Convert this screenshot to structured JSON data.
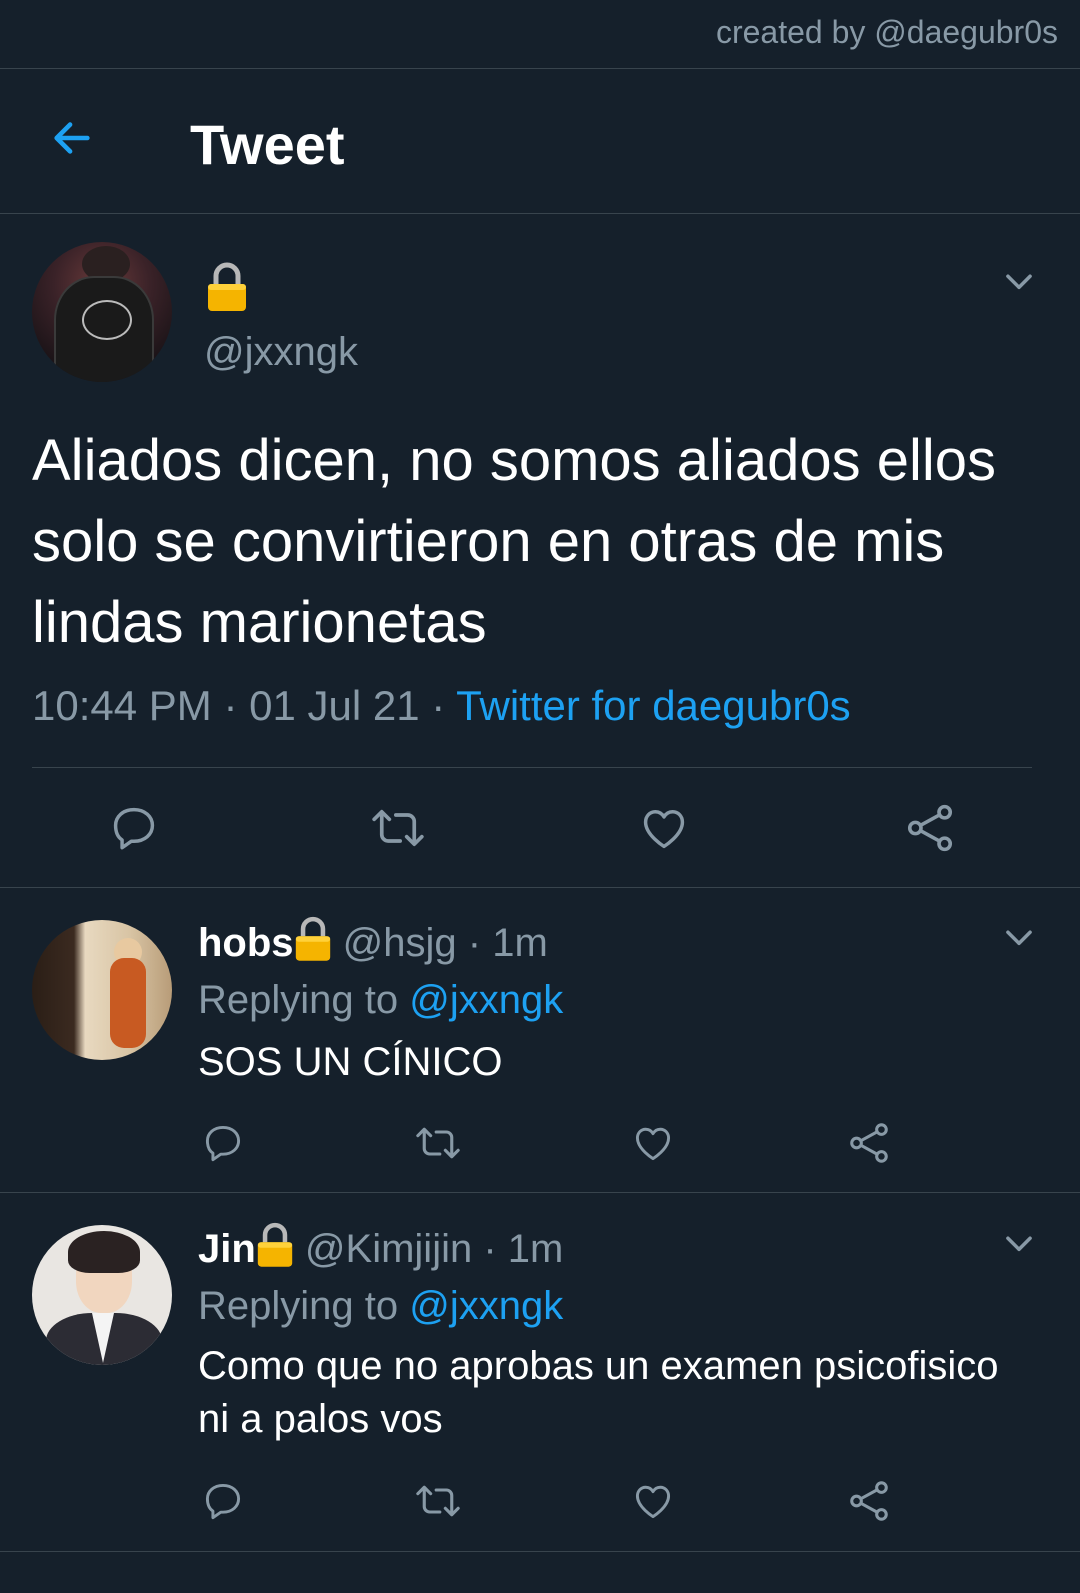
{
  "watermark": "created by @daegubr0s",
  "header": {
    "title": "Tweet",
    "back_icon": "arrow-left-icon"
  },
  "colors": {
    "background": "#15202b",
    "divider": "#38444d",
    "secondary_text": "#8899a6",
    "accent": "#1da1f2",
    "primary_text": "#ffffff"
  },
  "main_tweet": {
    "name": "",
    "protected": true,
    "handle": "@jxxngk",
    "text": "Aliados dicen, no somos aliados ellos solo se convirtieron en otras de mis lindas marionetas",
    "time": "10:44 PM",
    "date": "01 Jul 21",
    "source": "Twitter for daegubr0s",
    "sep": " · ",
    "actions": [
      "reply-icon",
      "retweet-icon",
      "like-icon",
      "share-icon"
    ]
  },
  "replies": [
    {
      "name": "hobs",
      "protected": true,
      "handle": "@hsjg",
      "time": "1m",
      "replying_label": "Replying to",
      "replying_to": "@jxxngk",
      "text": "SOS UN CÍNICO"
    },
    {
      "name": "Jin",
      "protected": true,
      "handle": "@Kimjijin",
      "time": "1m",
      "replying_label": "Replying to",
      "replying_to": "@jxxngk",
      "text": "Como que no aprobas un examen psicofisico ni a palos vos"
    }
  ]
}
